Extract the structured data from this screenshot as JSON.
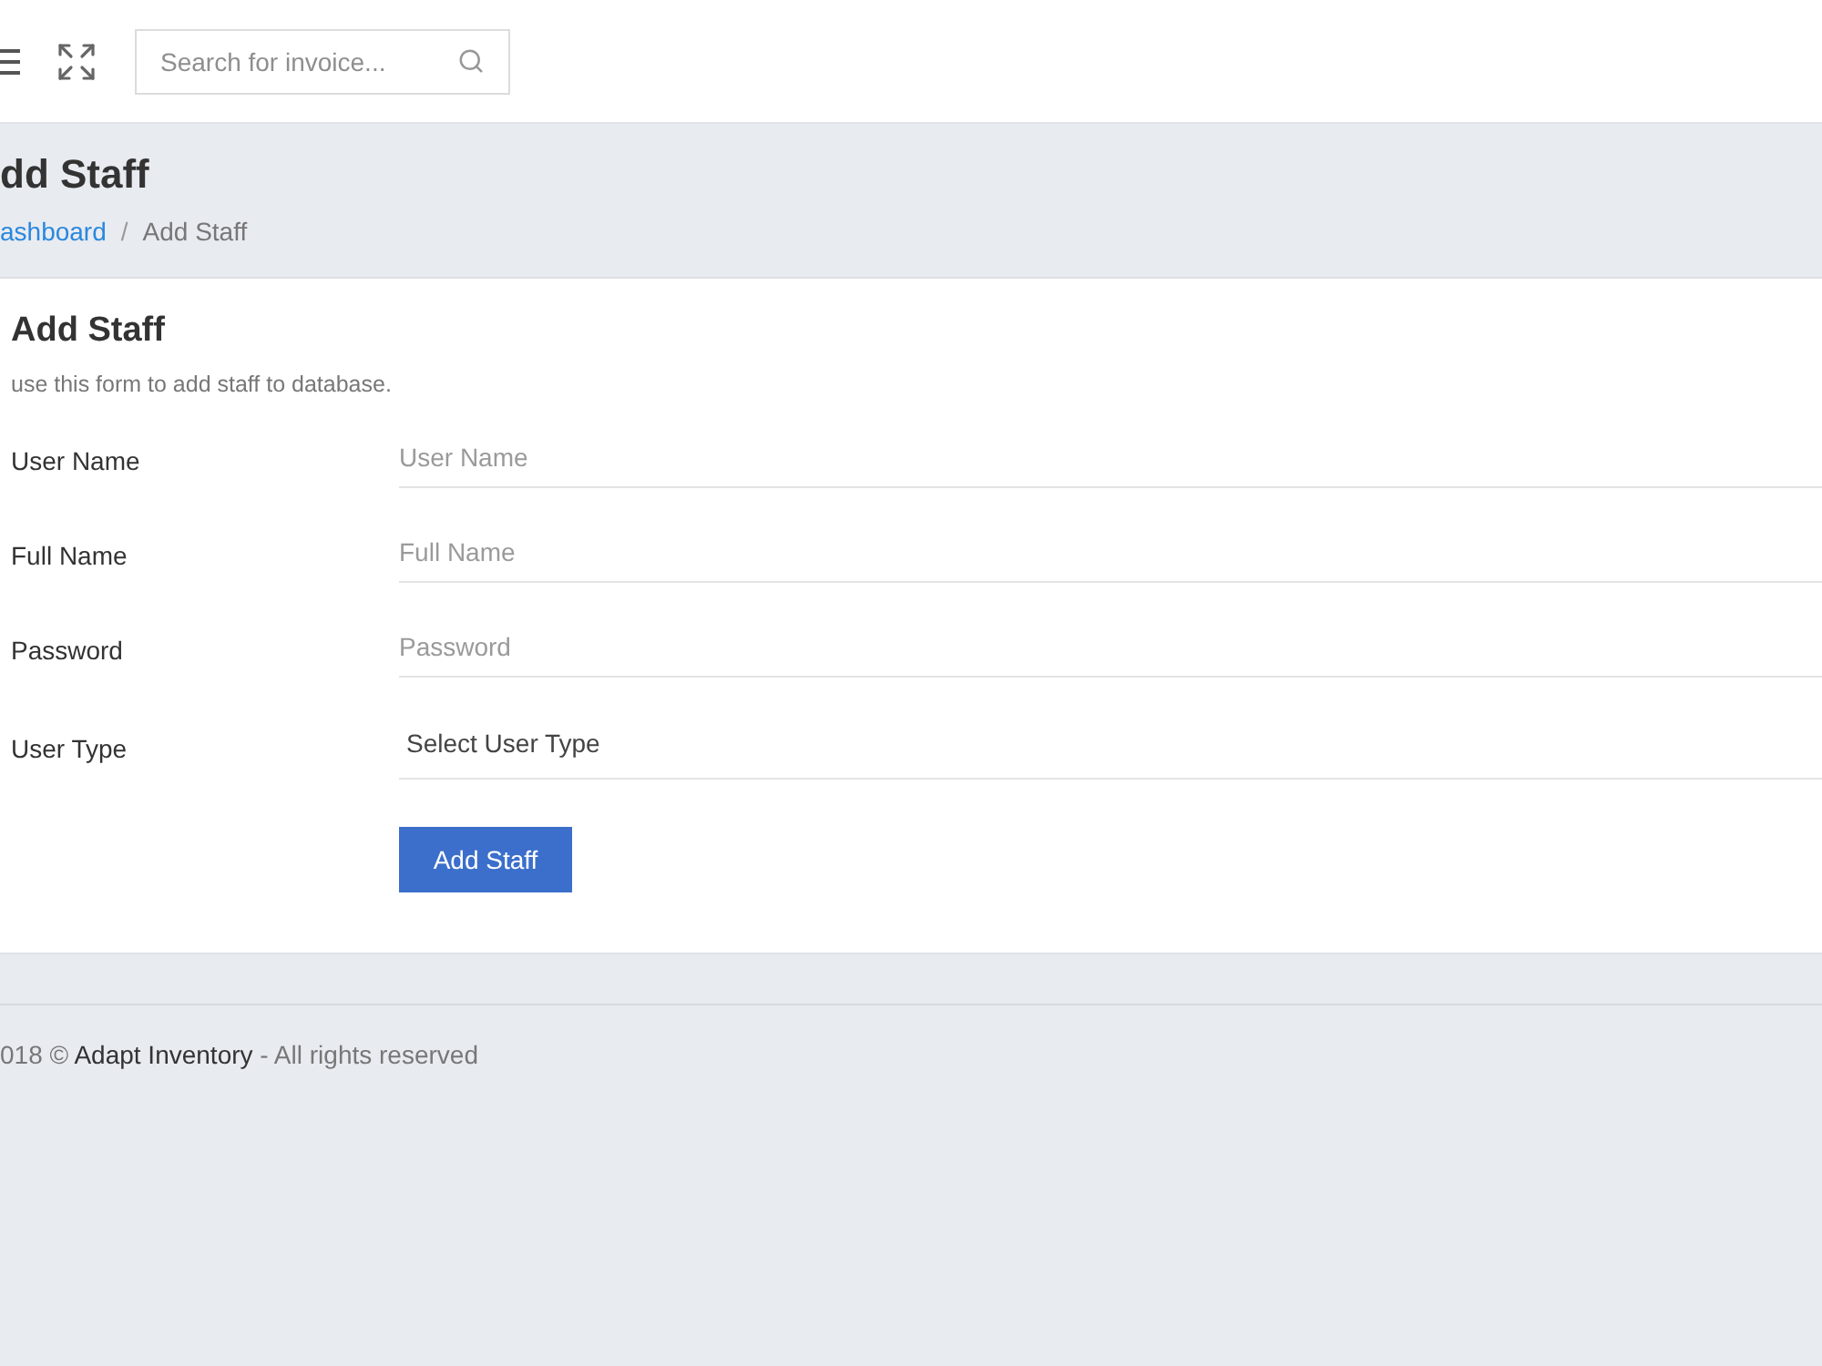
{
  "header": {
    "search": {
      "placeholder": "Search for invoice..."
    }
  },
  "page_header": {
    "title": "dd Staff",
    "breadcrumb": {
      "separator": "/",
      "items": [
        {
          "label": "ashboard",
          "kind": "link"
        },
        {
          "label": "Add Staff",
          "kind": "current"
        }
      ]
    }
  },
  "card": {
    "title": "Add Staff",
    "subtitle": "use this form to add staff to database.",
    "fields": [
      {
        "label": "User Name",
        "kind": "text",
        "placeholder": "User Name"
      },
      {
        "label": "Full Name",
        "kind": "text",
        "placeholder": "Full Name"
      },
      {
        "label": "Password",
        "kind": "password",
        "placeholder": "Password"
      },
      {
        "label": "User Type",
        "kind": "select",
        "value": "Select User Type"
      }
    ],
    "button": "Add Staff"
  },
  "footer": {
    "prefix": "018 ©",
    "brand": "Adapt Inventory",
    "suffix": "- All rights reserved"
  }
}
